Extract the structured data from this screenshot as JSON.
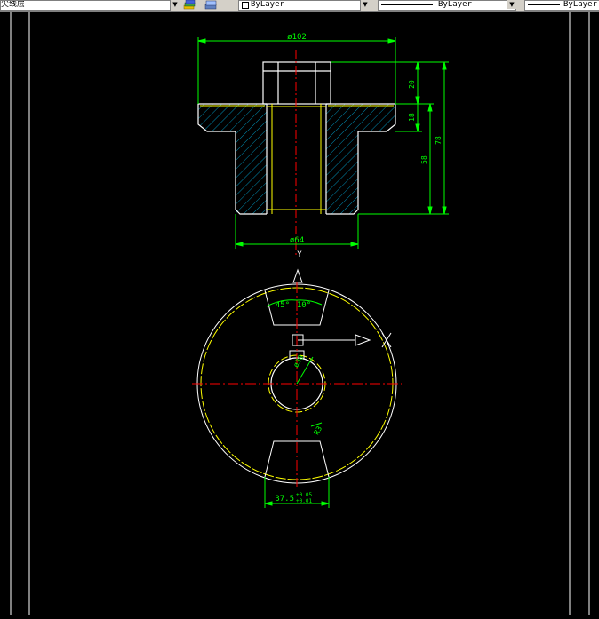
{
  "toolbar": {
    "layer_name": "尖线层",
    "color_value": "ByLayer",
    "linetype_value": "ByLayer",
    "lineweight_value": "ByLayer"
  },
  "drawing": {
    "section_view": {
      "dim_top_width": "ø102",
      "dim_hub_height": "20",
      "dim_flange_thickness": "18",
      "dim_body_height": "58",
      "dim_total_height": "78",
      "dim_bottom_width": "ø64",
      "view_arrow_label": "Y"
    },
    "plan_view": {
      "dim_angle_left": "45°",
      "dim_angle_right": "10°",
      "dim_bore_note": "ø30",
      "dim_slot_radius": "R3",
      "dim_slot_width": "37.5",
      "dim_tol_upper": "+0.05",
      "dim_tol_lower": "+0.01"
    }
  },
  "colors": {
    "background": "#000000",
    "outline": "#ffffff",
    "dimension": "#00ff00",
    "centerline": "#ff0000",
    "hatch": "#00c8ff",
    "hidden": "#ffff00",
    "toolbar": "#d4d0c8"
  }
}
